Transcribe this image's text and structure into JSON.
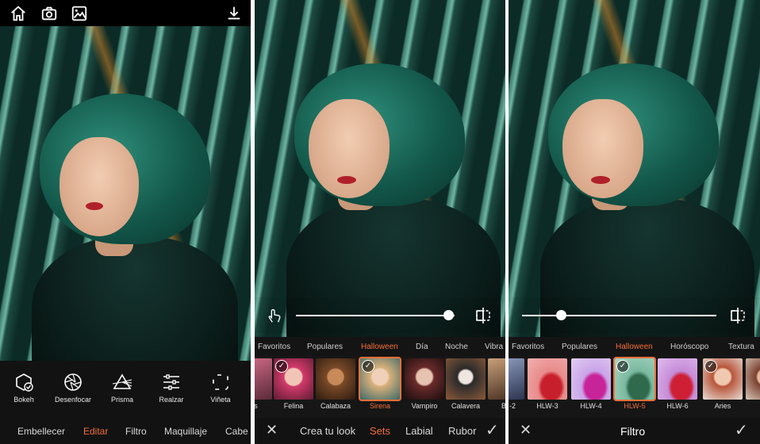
{
  "colors": {
    "accent": "#f26f3a",
    "bar": "#121212"
  },
  "screen1": {
    "topbar_icons": [
      "home-icon",
      "camera-icon",
      "gallery-icon",
      "download-icon"
    ],
    "tools": [
      {
        "label": "Bokeh",
        "icon": "bokeh-icon"
      },
      {
        "label": "Desenfocar",
        "icon": "aperture-icon"
      },
      {
        "label": "Prisma",
        "icon": "prism-icon"
      },
      {
        "label": "Realzar",
        "icon": "sliders-icon"
      },
      {
        "label": "Viñeta",
        "icon": "vignette-icon"
      }
    ],
    "tabs": [
      "Embellecer",
      "Editar",
      "Filtro",
      "Maquillaje",
      "Cabe"
    ],
    "active_tab": "Editar"
  },
  "screen2": {
    "slider_level": 0.96,
    "categories": [
      "Favoritos",
      "Populares",
      "Halloween",
      "Día",
      "Noche",
      "Vibra"
    ],
    "active_category": "Halloween",
    "looks": [
      "rs",
      "Felina",
      "Calabaza",
      "Sirena",
      "Vampiro",
      "Calavera",
      "B"
    ],
    "active_look": "Sirena",
    "bottom": {
      "close": "✕",
      "items": [
        "Crea tu look",
        "Sets",
        "Labial",
        "Rubor"
      ],
      "active": "Sets",
      "confirm": "✓"
    }
  },
  "screen3": {
    "slider_level": 0.2,
    "categories": [
      "Favoritos",
      "Populares",
      "Halloween",
      "Horóscopo",
      "Textura"
    ],
    "active_category": "Halloween",
    "filters": [
      "-2",
      "HLW-3",
      "HLW-4",
      "HLW-5",
      "HLW-6",
      "Aries",
      ""
    ],
    "active_filter": "HLW-5",
    "bottom": {
      "close": "✕",
      "title": "Filtro",
      "confirm": "✓"
    }
  }
}
